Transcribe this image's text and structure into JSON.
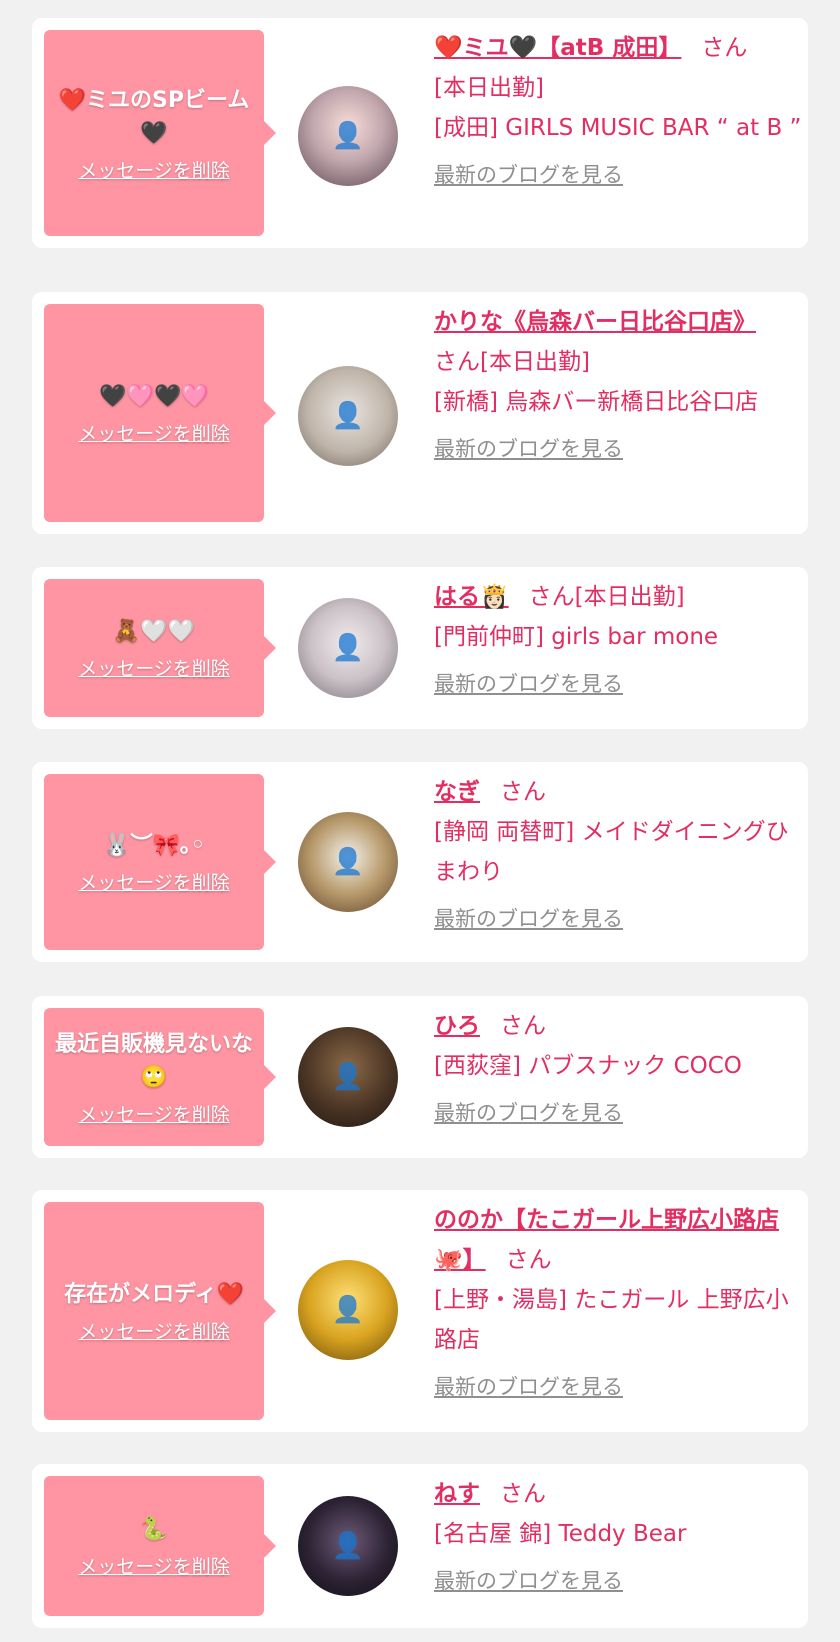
{
  "delete_label": "メッセージを削除",
  "san_label": "さん",
  "blog_label": "最新のブログを見る",
  "cards": [
    {
      "message_parts": [
        "❤️",
        "ミユのSPビーム",
        "🖤"
      ],
      "name": "❤️ミユ🖤【atB 成田】",
      "status": "[本日出勤]",
      "location": "[成田] GIRLS MUSIC BAR “ at B ”"
    },
    {
      "message_parts": [
        "🖤🩷🖤🩷"
      ],
      "name": "かりな《烏森バー日比谷口店》",
      "status": "[本日出勤]",
      "location": "[新橋] 烏森バー新橋日比谷口店"
    },
    {
      "message_parts": [
        "🧸🤍🤍"
      ],
      "name": "はる👸🏻",
      "status": "[本日出勤]",
      "location": "[門前仲町] girls bar mone"
    },
    {
      "message_parts": [
        "🐰︶🎀｡◦"
      ],
      "name": "なぎ",
      "status": "",
      "location": "[静岡 両替町] メイドダイニングひまわり"
    },
    {
      "message_parts": [
        "最近自販機見ないな",
        "🙄"
      ],
      "name": "ひろ",
      "status": "",
      "location": "[西荻窪] パブスナック COCO"
    },
    {
      "message_parts": [
        "存在がメロディ",
        "❤️"
      ],
      "name": "ののか【たこガール上野広小路店🐙】",
      "status": "",
      "location": "[上野・湯島] たこガール 上野広小路店"
    },
    {
      "message_parts": [
        "🐍"
      ],
      "name": "ねす",
      "status": "",
      "location": "[名古屋 錦] Teddy Bear"
    }
  ],
  "colors": {
    "background": "#f1f1f1",
    "bubble": "#ff95a3",
    "name_text": "#e22e62",
    "link_gray": "#8f8f8f"
  }
}
